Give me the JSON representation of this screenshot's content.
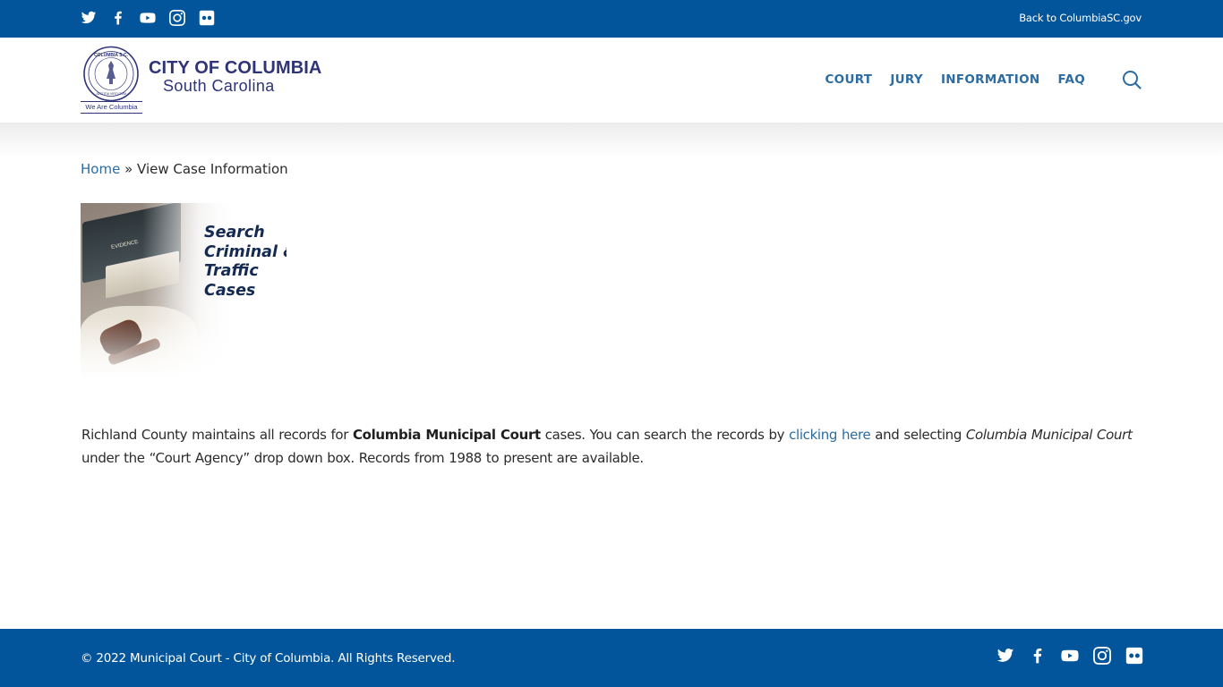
{
  "topbar": {
    "social_icons": [
      "twitter-icon",
      "facebook-icon",
      "youtube-icon",
      "instagram-icon",
      "flickr-icon"
    ],
    "back_link": "Back to ColumbiaSC.gov"
  },
  "header": {
    "logo": {
      "line1": "CITY OF COLUMBIA",
      "line2": "South Carolina",
      "seal_tagline": "We Are Columbia"
    },
    "nav": [
      {
        "label": "COURT"
      },
      {
        "label": "JURY"
      },
      {
        "label": "INFORMATION"
      },
      {
        "label": "FAQ"
      }
    ],
    "search_icon": "search-icon"
  },
  "breadcrumb": {
    "home": "Home",
    "separator": " » ",
    "current": "View Case Information"
  },
  "promo": {
    "lines": [
      "Search",
      "Criminal &",
      "Traffic",
      "Cases"
    ],
    "book_spine_text": "EVIDENCE"
  },
  "content": {
    "part1": "Richland County maintains all records for ",
    "bold": "Columbia Municipal Court",
    "part2": " cases. You can search the records by ",
    "link": "clicking here",
    "part3": " and selecting ",
    "italic": "Columbia Municipal Court",
    "part4": " under the “Court Agency” drop down box. Records from 1988 to present are available."
  },
  "footer": {
    "copyright": "© 2022 Municipal Court - City of Columbia. All Rights Reserved.",
    "social_icons": [
      "twitter-icon",
      "facebook-icon",
      "youtube-icon",
      "instagram-icon",
      "flickr-icon"
    ]
  },
  "colors": {
    "brand_blue": "#02559a",
    "nav_link": "#2c6ca3",
    "logo_navy": "#2e3477",
    "promo_text": "#142a52"
  }
}
